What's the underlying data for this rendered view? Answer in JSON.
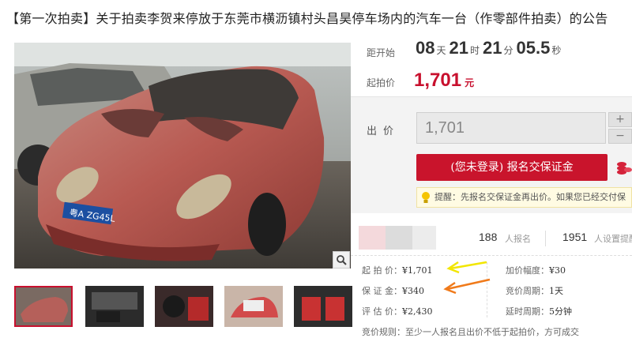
{
  "page": {
    "title": "【第一次拍卖】关于拍卖李贺来停放于东莞市横沥镇村头昌昊停车场内的汽车一台（作零部件拍卖）的公告"
  },
  "gallery": {
    "zoom_icon": "magnifier-icon",
    "thumbnails": [
      "thumb-1",
      "thumb-2",
      "thumb-3",
      "thumb-4",
      "thumb-5"
    ],
    "plate_text": "粤A ZG45L"
  },
  "countdown": {
    "label": "距开始",
    "days": "08",
    "days_unit": "天",
    "hours": "21",
    "hours_unit": "时",
    "minutes": "21",
    "minutes_unit": "分",
    "seconds": "05.5",
    "seconds_unit": "秒"
  },
  "start_price": {
    "label": "起拍价",
    "value": "1,701",
    "unit": "元"
  },
  "bid": {
    "label": "出价",
    "value": "1,701",
    "plus": "+",
    "minus": "−",
    "signup_button": "(您未登录) 报名交保证金",
    "tip": "提醒：先报名交保证金再出价。如果您已经交付保"
  },
  "stats": {
    "signups": "188",
    "signups_label": "人报名",
    "reminders": "1951",
    "reminders_label": "人设置提醒"
  },
  "details": {
    "start_price_label": "起 拍 价：",
    "start_price_value": "¥1,701",
    "deposit_label": "保 证 金：",
    "deposit_value": "¥340",
    "appraisal_label": "评 估 价：",
    "appraisal_value": "¥2,430",
    "increment_label": "加价幅度：",
    "increment_value": "¥30",
    "cycle_label": "竞价周期：",
    "cycle_value": "1天",
    "extension_label": "延时周期：",
    "extension_value": "5分钟",
    "rule_label": "竞价规则：",
    "rule_value": "至少一人报名且出价不低于起拍价，方可成交"
  },
  "colors": {
    "accent": "#c8102e",
    "arrow_yellow": "#f2e600",
    "arrow_orange": "#f07a1a"
  }
}
